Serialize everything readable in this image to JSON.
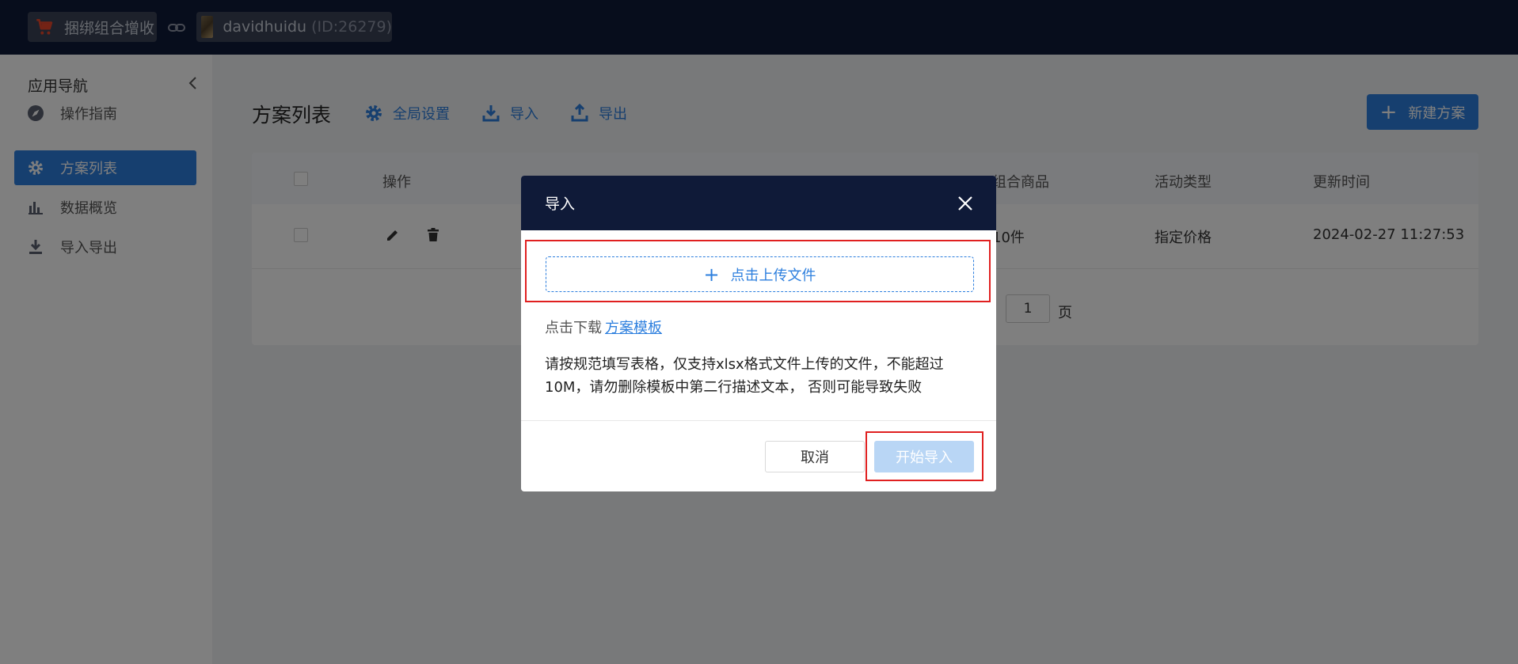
{
  "topbar": {
    "app_name": "捆绑组合增收",
    "user_name": "davidhuidu",
    "user_id": "(ID:26279)"
  },
  "sidebar": {
    "title": "应用导航",
    "items": [
      {
        "label": "操作指南",
        "icon": "compass-icon"
      },
      {
        "label": "方案列表",
        "icon": "gear-icon",
        "active": true
      },
      {
        "label": "数据概览",
        "icon": "bar-chart-icon"
      },
      {
        "label": "导入导出",
        "icon": "download-icon"
      }
    ]
  },
  "main": {
    "title": "方案列表",
    "toolbar": {
      "global_settings": "全局设置",
      "import": "导入",
      "export": "导出",
      "new_plan": "新建方案"
    },
    "table": {
      "headers": [
        "操作",
        "组合商品",
        "活动类型",
        "更新时间"
      ],
      "rows": [
        {
          "combo_goods": "10件",
          "activity_type": "指定价格",
          "updated_at": "2024-02-27 11:27:53"
        }
      ]
    },
    "pager": {
      "prefix": "：",
      "page": "1",
      "suffix": "页"
    }
  },
  "modal": {
    "title": "导入",
    "upload_label": "点击上传文件",
    "download_prefix": "点击下载",
    "download_link": "方案模板",
    "description": "请按规范填写表格，仅支持xlsx格式文件上传的文件，不能超过10M，请勿删除模板中第二行描述文本， 否则可能导致失败",
    "cancel": "取消",
    "start": "开始导入"
  },
  "colors": {
    "brand": "#2d7fde",
    "topbar": "#0f1a38",
    "highlight": "#e02020",
    "disabled_button": "#b9d6f5"
  }
}
